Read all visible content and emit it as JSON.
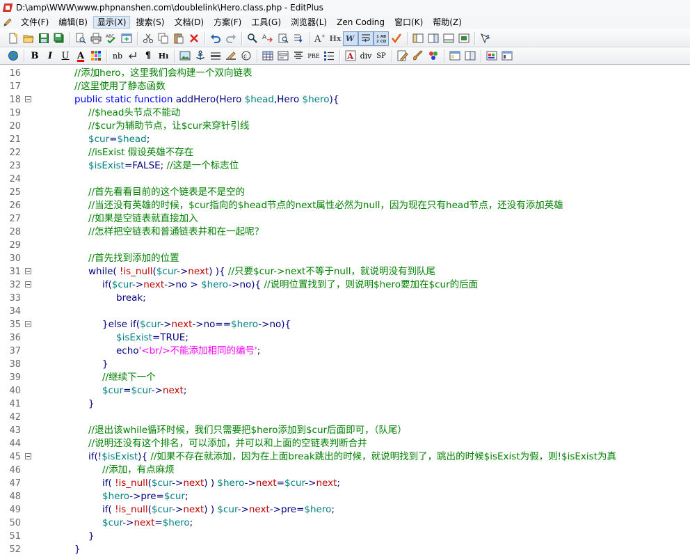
{
  "window": {
    "title": "D:\\amp\\WWW\\www.phpnanshen.com\\doublelink\\Hero.class.php - EditPlus"
  },
  "menu": {
    "items": [
      "文件(F)",
      "编辑(B)",
      "显示(X)",
      "搜索(S)",
      "文档(D)",
      "方案(F)",
      "工具(G)",
      "浏览器(L)",
      "Zen Coding",
      "窗口(K)",
      "帮助(Z)"
    ],
    "active_index": 2
  },
  "toolbar2_text": {
    "bold": "B",
    "italic": "I",
    "underline": "U",
    "font": "A",
    "nb": "nb",
    "para": "¶",
    "hi": "Hı",
    "pre": "PRE",
    "div": "div",
    "sp": "SP",
    "hx": "Hx"
  },
  "editor": {
    "lines": [
      {
        "n": "16",
        "fold": false,
        "indent": 0,
        "tokens": [
          [
            "c",
            "//添加hero，这里我们会构建一个双向链表"
          ]
        ]
      },
      {
        "n": "17",
        "fold": false,
        "indent": 0,
        "tokens": [
          [
            "c",
            "//这里使用了静态函数"
          ]
        ]
      },
      {
        "n": "18",
        "fold": true,
        "indent": 0,
        "tokens": [
          [
            "k",
            "public static function "
          ],
          [
            "p",
            "addHero(Hero "
          ],
          [
            "v",
            "$head"
          ],
          [
            "p",
            ",Hero "
          ],
          [
            "v",
            "$hero"
          ],
          [
            "p",
            "){"
          ]
        ]
      },
      {
        "n": "19",
        "fold": false,
        "indent": 1,
        "tokens": [
          [
            "c",
            "//$head头节点不能动"
          ]
        ]
      },
      {
        "n": "20",
        "fold": false,
        "indent": 1,
        "tokens": [
          [
            "c",
            "//$cur为辅助节点，让$cur来穿针引线"
          ]
        ]
      },
      {
        "n": "21",
        "fold": false,
        "indent": 1,
        "tokens": [
          [
            "v",
            "$cur"
          ],
          [
            "p",
            "="
          ],
          [
            "v",
            "$head"
          ],
          [
            "p",
            ";"
          ]
        ]
      },
      {
        "n": "22",
        "fold": false,
        "indent": 1,
        "tokens": [
          [
            "c",
            "//isExist 假设英雄不存在"
          ]
        ]
      },
      {
        "n": "23",
        "fold": false,
        "indent": 1,
        "tokens": [
          [
            "v",
            "$isExist"
          ],
          [
            "p",
            "=FALSE; "
          ],
          [
            "c",
            "//这是一个标志位"
          ]
        ]
      },
      {
        "n": "24",
        "fold": false,
        "indent": 0,
        "tokens": []
      },
      {
        "n": "25",
        "fold": false,
        "indent": 1,
        "tokens": [
          [
            "c",
            "//首先看看目前的这个链表是不是空的"
          ]
        ]
      },
      {
        "n": "26",
        "fold": false,
        "indent": 1,
        "tokens": [
          [
            "c",
            "//当还没有英雄的时候，$cur指向的$head节点的next属性必然为null，因为现在只有head节点，还没有添加英雄"
          ]
        ]
      },
      {
        "n": "27",
        "fold": false,
        "indent": 1,
        "tokens": [
          [
            "c",
            "//如果是空链表就直接加入"
          ]
        ]
      },
      {
        "n": "28",
        "fold": false,
        "indent": 1,
        "tokens": [
          [
            "c",
            "//怎样把空链表和普通链表并和在一起呢？"
          ]
        ]
      },
      {
        "n": "29",
        "fold": false,
        "indent": 0,
        "tokens": []
      },
      {
        "n": "30",
        "fold": false,
        "indent": 1,
        "tokens": [
          [
            "c",
            "//首先找到添加的位置"
          ]
        ]
      },
      {
        "n": "31",
        "fold": true,
        "indent": 1,
        "tokens": [
          [
            "p",
            "while( "
          ],
          [
            "r",
            "!is_null"
          ],
          [
            "p",
            "("
          ],
          [
            "v",
            "$cur"
          ],
          [
            "p",
            "->"
          ],
          [
            "r",
            "next"
          ],
          [
            "p",
            ") ){ "
          ],
          [
            "c",
            "//只要$cur->next不等于null，就说明没有到队尾"
          ]
        ]
      },
      {
        "n": "32",
        "fold": true,
        "indent": 2,
        "tokens": [
          [
            "p",
            "if("
          ],
          [
            "v",
            "$cur"
          ],
          [
            "p",
            "->"
          ],
          [
            "r",
            "next"
          ],
          [
            "p",
            "->no > "
          ],
          [
            "v",
            "$hero"
          ],
          [
            "p",
            "->no){ "
          ],
          [
            "c",
            "//说明位置找到了，则说明$hero要加在$cur的后面"
          ]
        ]
      },
      {
        "n": "33",
        "fold": false,
        "indent": 3,
        "tokens": [
          [
            "p",
            "break;"
          ]
        ]
      },
      {
        "n": "34",
        "fold": false,
        "indent": 0,
        "tokens": []
      },
      {
        "n": "35",
        "fold": true,
        "indent": 2,
        "tokens": [
          [
            "p",
            "}else if("
          ],
          [
            "v",
            "$cur"
          ],
          [
            "p",
            "->"
          ],
          [
            "r",
            "next"
          ],
          [
            "p",
            "->no=="
          ],
          [
            "v",
            "$hero"
          ],
          [
            "p",
            "->no){"
          ]
        ]
      },
      {
        "n": "36",
        "fold": false,
        "indent": 3,
        "tokens": [
          [
            "v",
            "$isExist"
          ],
          [
            "p",
            "=TRUE;"
          ]
        ]
      },
      {
        "n": "37",
        "fold": false,
        "indent": 3,
        "tokens": [
          [
            "p",
            "echo"
          ],
          [
            "s",
            "'<br/>不能添加相同的编号'"
          ],
          [
            "p",
            ";"
          ]
        ]
      },
      {
        "n": "38",
        "fold": false,
        "indent": 2,
        "tokens": [
          [
            "p",
            "}"
          ]
        ]
      },
      {
        "n": "39",
        "fold": false,
        "indent": 2,
        "tokens": [
          [
            "c",
            "//继续下一个"
          ]
        ]
      },
      {
        "n": "40",
        "fold": false,
        "indent": 2,
        "tokens": [
          [
            "v",
            "$cur"
          ],
          [
            "p",
            "="
          ],
          [
            "v",
            "$cur"
          ],
          [
            "p",
            "->"
          ],
          [
            "r",
            "next"
          ],
          [
            "p",
            ";"
          ]
        ]
      },
      {
        "n": "41",
        "fold": false,
        "indent": 1,
        "tokens": [
          [
            "p",
            "}"
          ]
        ]
      },
      {
        "n": "42",
        "fold": false,
        "indent": 0,
        "tokens": []
      },
      {
        "n": "43",
        "fold": false,
        "indent": 1,
        "tokens": [
          [
            "c",
            "//退出该while循环时候，我们只需要把$hero添加到$cur后面即可，（队尾）"
          ]
        ]
      },
      {
        "n": "44",
        "fold": false,
        "indent": 1,
        "tokens": [
          [
            "c",
            "//说明还没有这个排名，可以添加，并可以和上面的空链表判断合并"
          ]
        ]
      },
      {
        "n": "45",
        "fold": true,
        "indent": 1,
        "tokens": [
          [
            "p",
            "if(!"
          ],
          [
            "v",
            "$isExist"
          ],
          [
            "p",
            "){ "
          ],
          [
            "c",
            "//如果不存在就添加，因为在上面break跳出的时候，就说明找到了，跳出的时候$isExist为假，则!$isExist为真"
          ]
        ]
      },
      {
        "n": "46",
        "fold": false,
        "indent": 2,
        "tokens": [
          [
            "c",
            "//添加，有点麻烦"
          ]
        ]
      },
      {
        "n": "47",
        "fold": false,
        "indent": 2,
        "tokens": [
          [
            "p",
            "if( "
          ],
          [
            "r",
            "!is_null"
          ],
          [
            "p",
            "("
          ],
          [
            "v",
            "$cur"
          ],
          [
            "p",
            "->"
          ],
          [
            "r",
            "next"
          ],
          [
            "p",
            ") ) "
          ],
          [
            "v",
            "$hero"
          ],
          [
            "p",
            "->"
          ],
          [
            "r",
            "next"
          ],
          [
            "p",
            "="
          ],
          [
            "v",
            "$cur"
          ],
          [
            "p",
            "->"
          ],
          [
            "r",
            "next"
          ],
          [
            "p",
            ";"
          ]
        ]
      },
      {
        "n": "48",
        "fold": false,
        "indent": 2,
        "tokens": [
          [
            "v",
            "$hero"
          ],
          [
            "p",
            "->pre="
          ],
          [
            "v",
            "$cur"
          ],
          [
            "p",
            ";"
          ]
        ]
      },
      {
        "n": "49",
        "fold": false,
        "indent": 2,
        "tokens": [
          [
            "p",
            "if( "
          ],
          [
            "r",
            "!is_null"
          ],
          [
            "p",
            "("
          ],
          [
            "v",
            "$cur"
          ],
          [
            "p",
            "->"
          ],
          [
            "r",
            "next"
          ],
          [
            "p",
            ") ) "
          ],
          [
            "v",
            "$cur"
          ],
          [
            "p",
            "->"
          ],
          [
            "r",
            "next"
          ],
          [
            "p",
            "->pre="
          ],
          [
            "v",
            "$hero"
          ],
          [
            "p",
            ";"
          ]
        ]
      },
      {
        "n": "50",
        "fold": false,
        "indent": 2,
        "tokens": [
          [
            "v",
            "$cur"
          ],
          [
            "p",
            "->"
          ],
          [
            "r",
            "next"
          ],
          [
            "p",
            "="
          ],
          [
            "v",
            "$hero"
          ],
          [
            "p",
            ";"
          ]
        ]
      },
      {
        "n": "51",
        "fold": false,
        "indent": 1,
        "tokens": [
          [
            "p",
            "}"
          ]
        ]
      },
      {
        "n": "52",
        "fold": false,
        "indent": 0,
        "tokens": [
          [
            "p",
            "}"
          ]
        ]
      }
    ]
  },
  "colors": {
    "comment": "#008000",
    "keyword": "#0000ff",
    "variable": "#008080",
    "plain": "#000080",
    "function_red": "#c00000",
    "string": "#ff00ff"
  }
}
